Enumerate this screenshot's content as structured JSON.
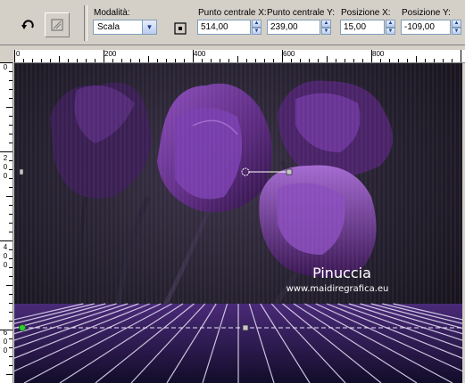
{
  "toolbar": {
    "mode_label": "Modalità:",
    "mode_value": "Scala",
    "center_x_label": "Punto centrale X:",
    "center_x_value": "514,00",
    "center_y_label": "Punto centrale Y:",
    "center_y_value": "239,00",
    "pos_x_label": "Posizione X:",
    "pos_x_value": "15,00",
    "pos_y_label": "Posizione Y:",
    "pos_y_value": "-109,00"
  },
  "ruler": {
    "h_labels": [
      "0",
      "200",
      "400",
      "600",
      "800"
    ],
    "v_labels": [
      [
        "0"
      ],
      [
        "2",
        "0",
        "0"
      ],
      [
        "4",
        "0",
        "0"
      ],
      [
        "6",
        "0",
        "0"
      ]
    ]
  },
  "watermark": {
    "name": "Pinuccia",
    "url": "www.maidiregrafica.eu"
  },
  "colors": {
    "toolbar_bg": "#d4d0c8",
    "canvas_bg": "#1b1722",
    "petal": "#5b2a7e",
    "petal_light": "#8e4fbe",
    "grid_line": "#dcd6ee"
  }
}
